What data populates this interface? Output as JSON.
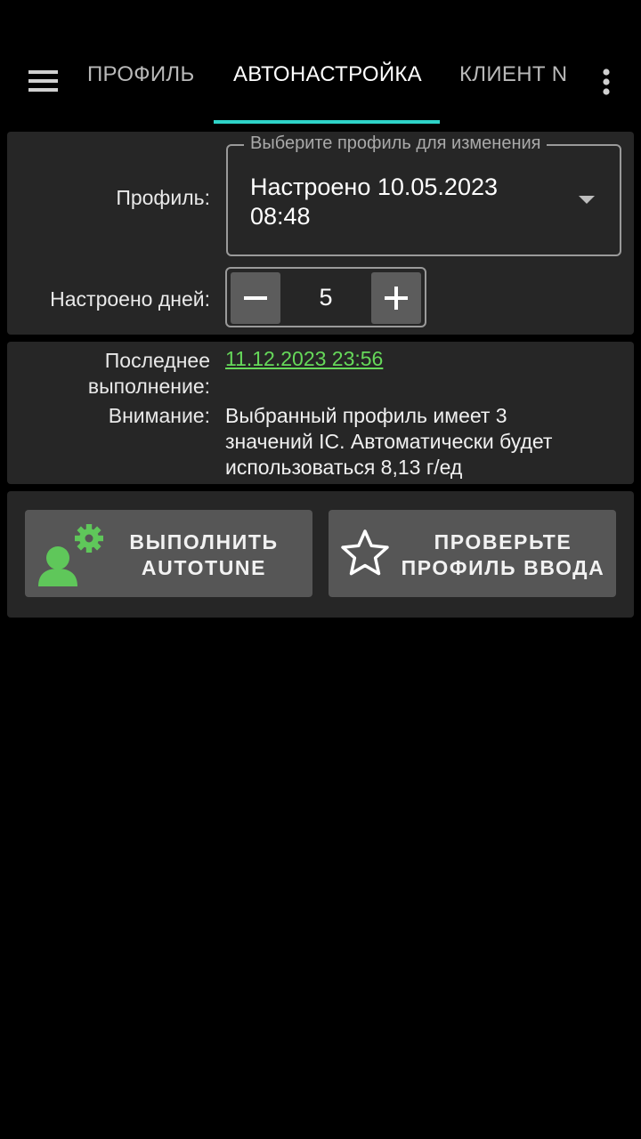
{
  "tabs": [
    {
      "label": "ПРОФИЛЬ"
    },
    {
      "label": "АВТОНАСТРОЙКА"
    },
    {
      "label": "КЛИЕНТ N"
    }
  ],
  "profile_section": {
    "profile_label": "Профиль:",
    "dropdown_hint": "Выберите профиль для изменения",
    "dropdown_value_line1": "Настроено 10.05.2023",
    "dropdown_value_line2": "08:48",
    "days_label": "Настроено дней:",
    "days_value": "5"
  },
  "info_section": {
    "last_run_label_line1": "Последнее",
    "last_run_label_line2": "выполнение:",
    "last_run_value": "11.12.2023 23:56",
    "warning_label": "Внимание:",
    "warning_line1": "Выбранный профиль имеет 3",
    "warning_line2": "значений IC. Автоматически будет",
    "warning_line3": "использоваться 8,13 г/ед"
  },
  "actions": {
    "run_line1": "ВЫПОЛНИТЬ",
    "run_line2": "AUTOTUNE",
    "run_icon": "person-gear-icon",
    "check_line1": "ПРОВЕРЬТЕ",
    "check_line2": "ПРОФИЛЬ ВВОДА",
    "check_icon": "star-outline-icon"
  },
  "colors": {
    "background": "#000000",
    "card": "#262626",
    "accent_tab": "#2ed3c8",
    "link_green": "#66d95a",
    "button": "#565656"
  }
}
